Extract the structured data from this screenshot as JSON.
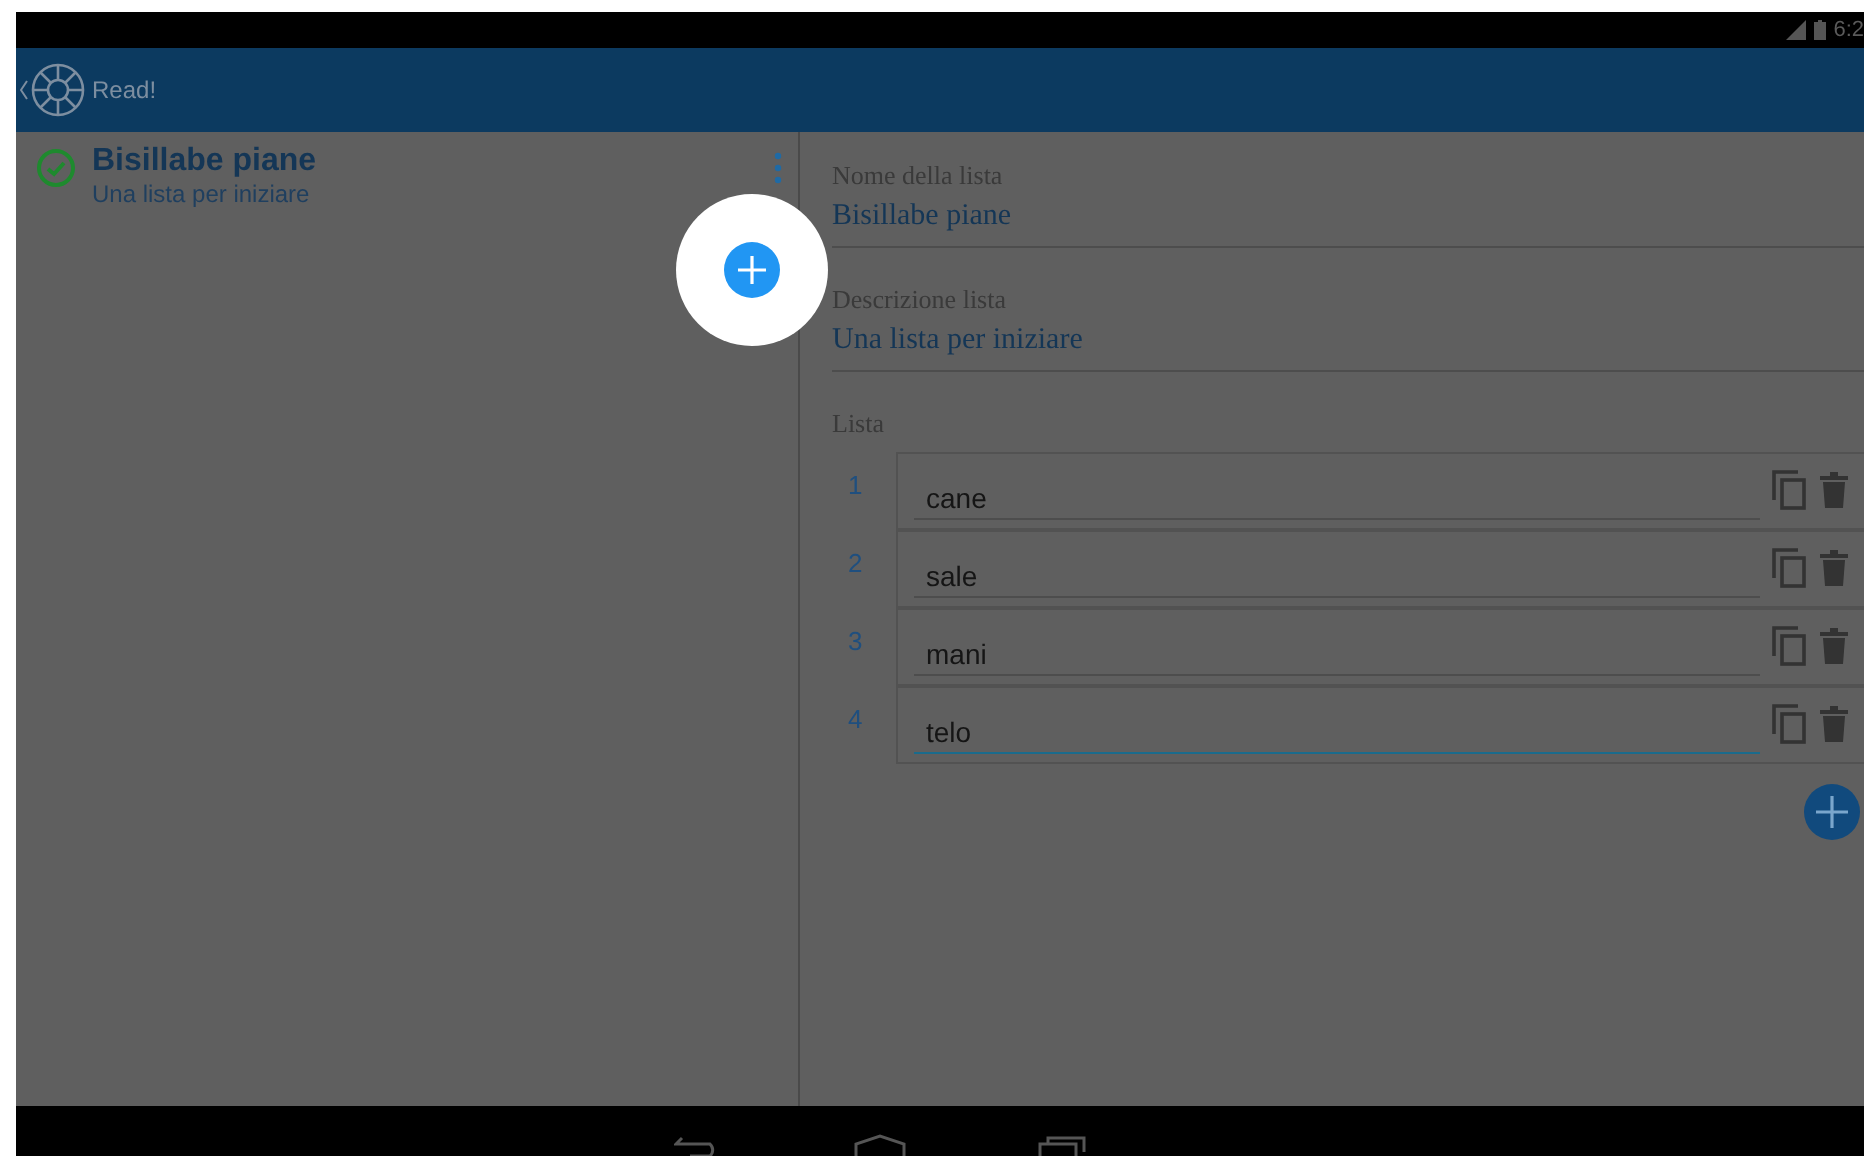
{
  "status_bar": {
    "time": "6:2"
  },
  "app_bar": {
    "title": "Read!"
  },
  "lists": [
    {
      "title": "Bisillabe piane",
      "subtitle": "Una lista per iniziare",
      "done": true
    }
  ],
  "editor": {
    "name_label": "Nome della lista",
    "name_value": "Bisillabe piane",
    "description_label": "Descrizione lista",
    "description_value": "Una lista per iniziare",
    "items_label": "Lista",
    "items": [
      {
        "number": "1",
        "word": "cane",
        "focused": false
      },
      {
        "number": "2",
        "word": "sale",
        "focused": false
      },
      {
        "number": "3",
        "word": "mani",
        "focused": false
      },
      {
        "number": "4",
        "word": "telo",
        "focused": true
      }
    ]
  }
}
